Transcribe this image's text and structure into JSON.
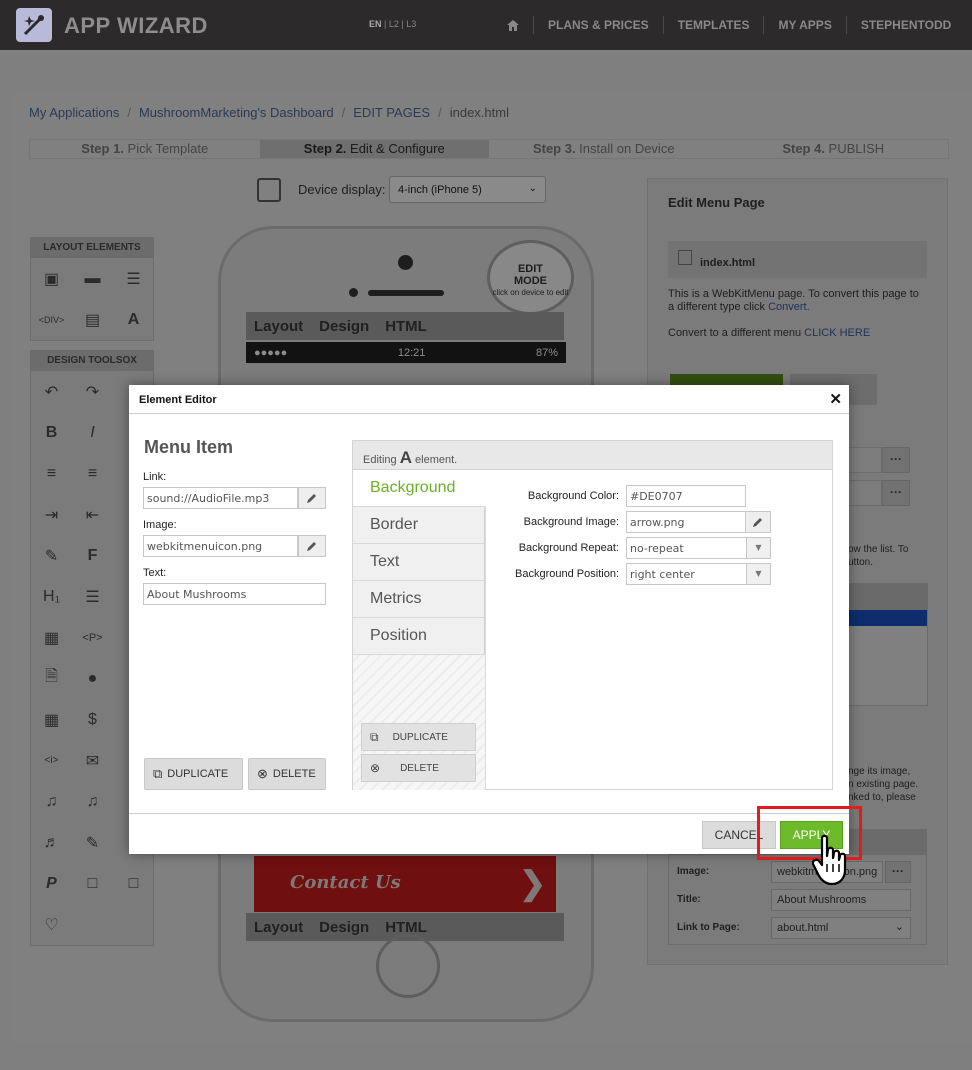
{
  "header": {
    "app_name": "APP WIZARD",
    "languages": [
      "EN",
      "L2",
      "L3"
    ],
    "nav": [
      "PLANS & PRICES",
      "TEMPLATES",
      "MY APPS",
      "STEPHENTODD"
    ]
  },
  "breadcrumb": [
    "My Applications",
    "MushroomMarketing's Dashboard",
    "EDIT PAGES",
    "index.html"
  ],
  "steps": [
    {
      "num": "Step 1.",
      "label": " Pick Template"
    },
    {
      "num": "Step 2.",
      "label": " Edit & Configure"
    },
    {
      "num": "Step 3.",
      "label": " Install on Device"
    },
    {
      "num": "Step 4.",
      "label": " PUBLISH"
    }
  ],
  "device": {
    "label": "Device display:",
    "selected": "4-inch (iPhone 5)"
  },
  "palette": {
    "layout_title": "LAYOUT ELEMENTS",
    "tools_title": "DESIGN TOOLSOX"
  },
  "phone": {
    "badge_top": "EDIT",
    "badge_mid": "MODE",
    "badge_small": "click on device to edit",
    "tabs": [
      "Layout",
      "Design",
      "HTML"
    ],
    "status_time": "12:21",
    "status_battery": "87%",
    "contact_label": "Contact Us"
  },
  "right_panel": {
    "title": "Edit Menu Page",
    "file": "index.html",
    "info_1": "This is a WebKitMenu page. To convert this page to a different type click ",
    "info_link_1": "Convert.",
    "info_2": "Convert to a different menu ",
    "info_link_2": "CLICK HERE",
    "hint_1": "ow the list. To",
    "hint_2": "utton.",
    "hint_3": "nge its image,",
    "hint_4": "n existing page.",
    "hint_5": "nked to, please",
    "form": {
      "image_label": "Image:",
      "image_value": "webkitmenuicon.png",
      "title_label": "Title:",
      "title_value": "About Mushrooms",
      "link_label": "Link to Page:",
      "link_value": "about.html"
    }
  },
  "modal": {
    "title": "Element Editor",
    "item_title": "Menu Item",
    "link_label": "Link:",
    "link_value": "sound://AudioFile.mp3",
    "image_label": "Image:",
    "image_value": "webkitmenuicon.png",
    "text_label": "Text:",
    "text_value": "About Mushrooms",
    "duplicate": "DUPLICATE",
    "delete": "DELETE",
    "editing_pre": "Editing ",
    "editing_glyph": "A",
    "editing_post": " element.",
    "tabs": [
      "Background",
      "Border",
      "Text",
      "Metrics",
      "Position"
    ],
    "props": {
      "bg_color_label": "Background Color:",
      "bg_color_value": "#DE0707",
      "bg_image_label": "Background Image:",
      "bg_image_value": "arrow.png",
      "bg_repeat_label": "Background Repeat:",
      "bg_repeat_value": "no-repeat",
      "bg_position_label": "Background Position:",
      "bg_position_value": "right center"
    },
    "cancel": "CANCEL",
    "apply": "APPLY"
  },
  "colors": {
    "accent_green": "#6dba2a",
    "highlight_red": "#e21b1b",
    "tab_active": "#6ab027"
  }
}
